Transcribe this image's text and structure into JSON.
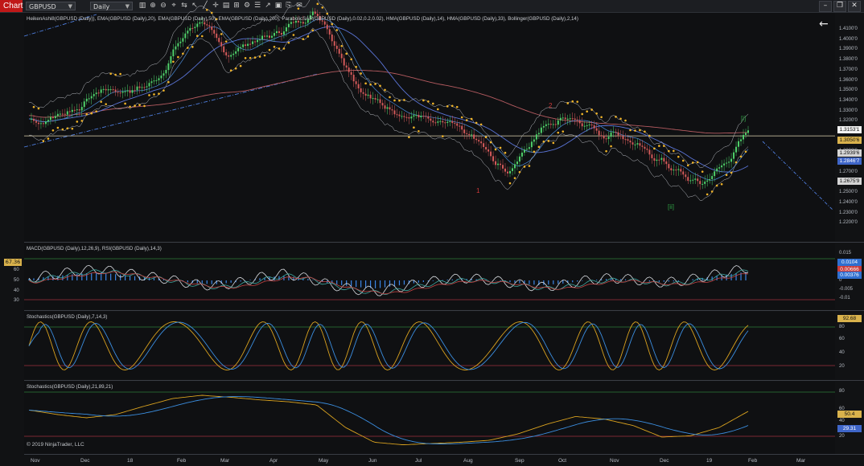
{
  "toolbar": {
    "tab_label": "Chart",
    "instrument": "GBPUSD",
    "timeframe": "Daily",
    "icons": [
      "bar-type-icon",
      "zoom-in-icon",
      "zoom-out-icon",
      "crosshair-icon",
      "scroll-icon",
      "pointer-icon",
      "draw-line-icon",
      "cross-icon",
      "data-box-icon",
      "grid-icon",
      "strategy-icon",
      "properties-icon",
      "share-icon",
      "template-icon",
      "attach-icon",
      "email-icon"
    ],
    "window_controls": [
      "minimize",
      "restore",
      "close"
    ]
  },
  "panels": {
    "price": {
      "label": "HeikenAshi8(GBPUSD (Daily)), EMA(GBPUSD (Daily),20), EMA(GBPUSD (Daily),50), EMA(GBPUSD (Daily),200), ParabolicSAR(GBPUSD (Daily),0.02,0.2,0.02), HMA(GBPUSD (Daily),14), HMA(GBPUSD (Daily),33), Bollinger(GBPUSD (Daily),2,14)",
      "scale": [
        "1.4100'0",
        "1.4000'0",
        "1.3900'0",
        "1.3800'0",
        "1.3700'0",
        "1.3600'0",
        "1.3500'0",
        "1.3400'0",
        "1.3300'0",
        "1.3200'0",
        "1.3100'0",
        "1.3000'0",
        "1.2900'0",
        "1.2800'0",
        "1.2700'0",
        "1.2600'0",
        "1.2500'0",
        "1.2400'0",
        "1.2300'0",
        "1.2200'0"
      ],
      "tags": [
        {
          "text": "1.3153'1",
          "bg": "#f2f2f2",
          "fg": "#111111"
        },
        {
          "text": "1.3050'6",
          "bg": "#d9b24c",
          "fg": "#111111"
        },
        {
          "text": "1.2939'6",
          "bg": "#d4d4d4",
          "fg": "#111111"
        },
        {
          "text": "1.2846'7",
          "bg": "#3f66c9",
          "fg": "#ffffff"
        },
        {
          "text": "1.2675'9",
          "bg": "#d4d4d4",
          "fg": "#111111"
        }
      ],
      "wave_labels": [
        {
          "text": "2",
          "color": "#d23a3a"
        },
        {
          "text": "1",
          "color": "#d23a3a"
        },
        {
          "text": "[i]",
          "color": "#2e9c42"
        },
        {
          "text": "[ii]",
          "color": "#2e9c42"
        }
      ]
    },
    "macd": {
      "label": "MACD(GBPUSD (Daily),12,26,9), RSI(GBPUSD (Daily),14,3)",
      "left_scale": [
        "60",
        "50",
        "40",
        "30"
      ],
      "left_tag": "67.36",
      "right_scale": [
        "0.015",
        "0.005",
        "0",
        "-0.005",
        "-0.01"
      ],
      "tags": [
        {
          "text": "0.0104",
          "bg": "#2f6fd0",
          "fg": "#ffffff"
        },
        {
          "text": "0.00666",
          "bg": "#c93a3a",
          "fg": "#ffffff"
        },
        {
          "text": "0.00376",
          "bg": "#2f6fd0",
          "fg": "#ffffff"
        }
      ]
    },
    "stoch1": {
      "label": "Stochastics(GBPUSD (Daily),7,14,3)",
      "scale": [
        "80",
        "60",
        "40",
        "20"
      ],
      "tag": {
        "text": "92.68",
        "bg": "#d9b24c",
        "fg": "#111111"
      }
    },
    "stoch2": {
      "label": "Stochastics(GBPUSD (Daily),21,89,21)",
      "scale": [
        "80",
        "60",
        "40",
        "20"
      ],
      "tags": [
        {
          "text": "50.4",
          "bg": "#d9b24c",
          "fg": "#111111"
        },
        {
          "text": "29.31",
          "bg": "#3f66c9",
          "fg": "#ffffff"
        }
      ]
    }
  },
  "xaxis": [
    "Nov",
    "Dec",
    "18",
    "Feb",
    "Mar",
    "Apr",
    "May",
    "Jun",
    "Jul",
    "Aug",
    "Sep",
    "Oct",
    "Nov",
    "Dec",
    "19",
    "Feb",
    "Mar"
  ],
  "copyright": "© 2019 NinjaTrader, LLC",
  "colors": {
    "bull": "#4fd16a",
    "bear": "#d45a5a",
    "sar": "#f0b429",
    "ema_blue": "#5a74d6",
    "ema_red": "#b55b60",
    "boll": "#b9bcc2",
    "rsi": "#d7dadf",
    "stoch_k": "#d9a21f",
    "stoch_d": "#3b8ee0",
    "hline_green": "#2e7d3a",
    "hline_red": "#a0303c"
  }
}
